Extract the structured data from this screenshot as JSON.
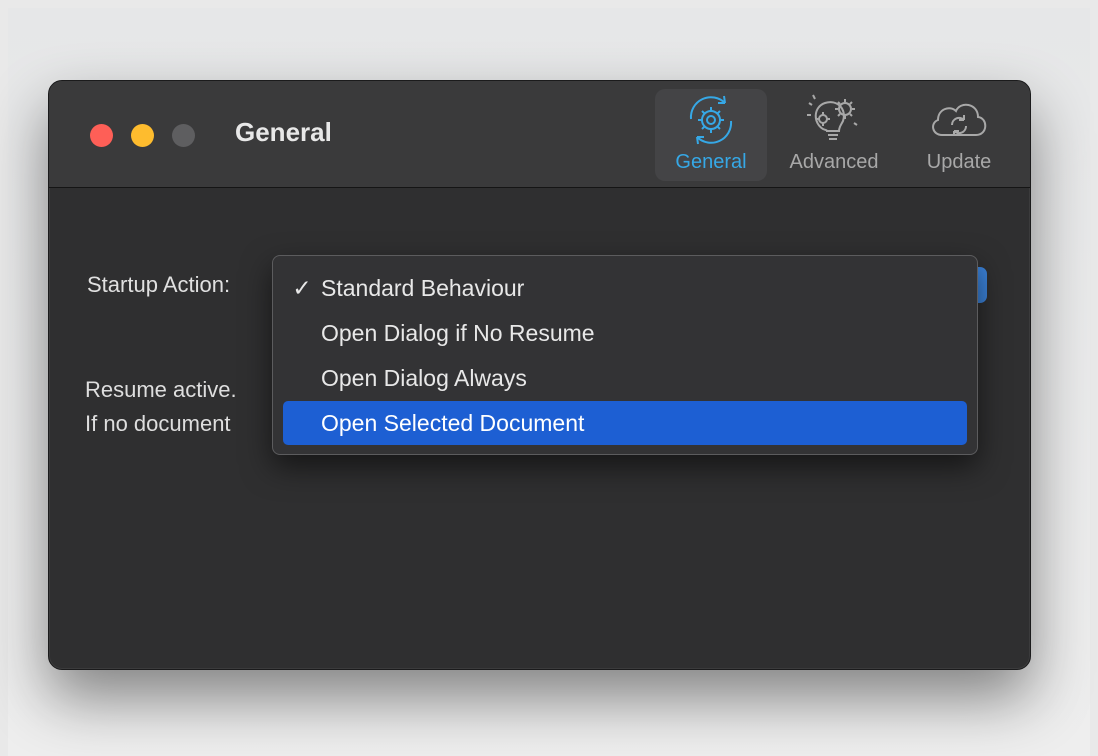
{
  "window": {
    "title": "General"
  },
  "toolbar": {
    "items": [
      {
        "label": "General",
        "icon": "gear-sync-icon",
        "active": true
      },
      {
        "label": "Advanced",
        "icon": "gear-lightbulb-icon",
        "active": false
      },
      {
        "label": "Update",
        "icon": "cloud-sync-icon",
        "active": false
      }
    ],
    "accent_color": "#36a8e6"
  },
  "startup": {
    "label": "Startup Action:",
    "selected": "Standard Behaviour",
    "options": [
      {
        "label": "Standard Behaviour",
        "checked": true,
        "highlighted": false
      },
      {
        "label": "Open Dialog if No Resume",
        "checked": false,
        "highlighted": false
      },
      {
        "label": "Open Dialog Always",
        "checked": false,
        "highlighted": false
      },
      {
        "label": "Open Selected Document",
        "checked": false,
        "highlighted": true
      }
    ],
    "check_mark": "✓",
    "highlight_color": "#1d5fd3"
  },
  "description": {
    "line1": "Resume active.",
    "line2": "If no document"
  },
  "traffic_lights": {
    "close_color": "#fe5f57",
    "minimize_color": "#febc2e",
    "zoom_color": "#5e5e60"
  }
}
